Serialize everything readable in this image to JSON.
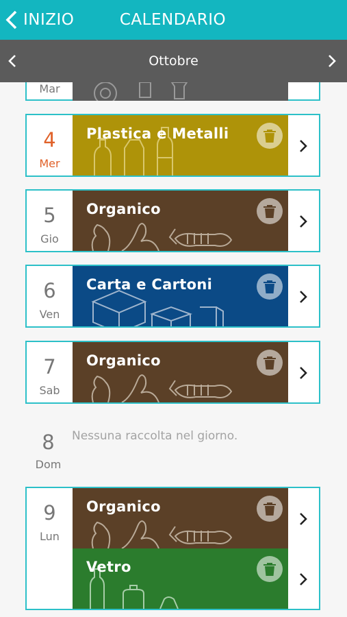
{
  "header": {
    "back_label": "INIZIO",
    "title": "CALENDARIO"
  },
  "month_bar": {
    "month": "Ottobre"
  },
  "partial_day": {
    "dow": "Mar"
  },
  "days": [
    {
      "num": "4",
      "dow": "Mer",
      "today": true,
      "collections": [
        {
          "label": "Plastica e Metalli",
          "color": "#ae9309",
          "art": "plastic"
        }
      ]
    },
    {
      "num": "5",
      "dow": "Gio",
      "collections": [
        {
          "label": "Organico",
          "color": "#5b4027",
          "art": "organic"
        }
      ]
    },
    {
      "num": "6",
      "dow": "Ven",
      "collections": [
        {
          "label": "Carta e Cartoni",
          "color": "#0b4a86",
          "art": "paper"
        }
      ]
    },
    {
      "num": "7",
      "dow": "Sab",
      "collections": [
        {
          "label": "Organico",
          "color": "#5b4027",
          "art": "organic"
        }
      ]
    },
    {
      "num": "8",
      "dow": "Dom",
      "empty_message": "Nessuna raccolta nel giorno."
    },
    {
      "num": "9",
      "dow": "Lun",
      "collections": [
        {
          "label": "Organico",
          "color": "#5b4027",
          "art": "organic"
        },
        {
          "label": "Vetro",
          "color": "#2b7c2d",
          "art": "glass"
        }
      ]
    }
  ],
  "icons": {
    "back": "chevron-left-icon",
    "prev": "chevron-left-icon",
    "next": "chevron-right-icon",
    "trash": "trash-bin-icon",
    "row": "chevron-right-icon"
  }
}
